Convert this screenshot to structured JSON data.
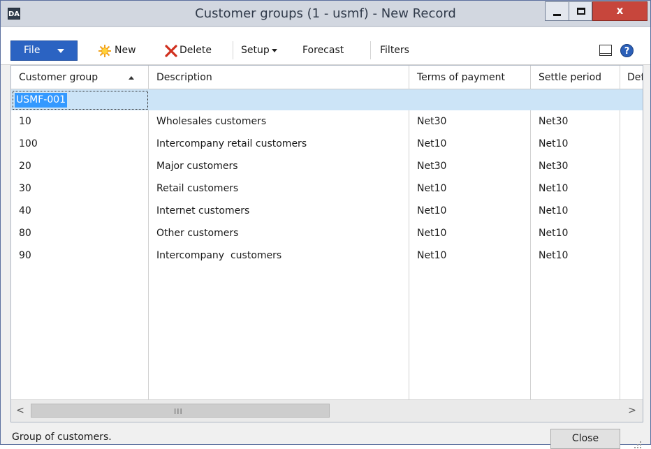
{
  "window": {
    "title": "Customer groups (1 - usmf) - New Record",
    "app_icon_label": "DA",
    "close_label": "x"
  },
  "toolbar": {
    "file_label": "File",
    "new_label": "New",
    "delete_label": "Delete",
    "setup_label": "Setup",
    "forecast_label": "Forecast",
    "filters_label": "Filters",
    "help_label": "?"
  },
  "grid": {
    "columns": [
      "Customer group",
      "Description",
      "Terms of payment",
      "Settle period",
      "Def"
    ],
    "new_record_value": "USMF-001",
    "rows": [
      {
        "group": "10",
        "description": "Wholesales customers",
        "terms": "Net30",
        "settle": "Net30"
      },
      {
        "group": "100",
        "description": "Intercompany retail customers",
        "terms": "Net10",
        "settle": "Net10"
      },
      {
        "group": "20",
        "description": "Major customers",
        "terms": "Net30",
        "settle": "Net30"
      },
      {
        "group": "30",
        "description": "Retail customers",
        "terms": "Net10",
        "settle": "Net10"
      },
      {
        "group": "40",
        "description": "Internet customers",
        "terms": "Net10",
        "settle": "Net10"
      },
      {
        "group": "80",
        "description": "Other customers",
        "terms": "Net10",
        "settle": "Net10"
      },
      {
        "group": "90",
        "description": "Intercompany  customers",
        "terms": "Net10",
        "settle": "Net10"
      }
    ],
    "scroll_left": "<",
    "scroll_right": ">",
    "scroll_grip": "III"
  },
  "status": {
    "text": "Group of customers.",
    "close_button": "Close"
  },
  "colors": {
    "file_button": "#2b63c2",
    "selected_row": "#cce4f7",
    "close_window": "#c7463c"
  }
}
